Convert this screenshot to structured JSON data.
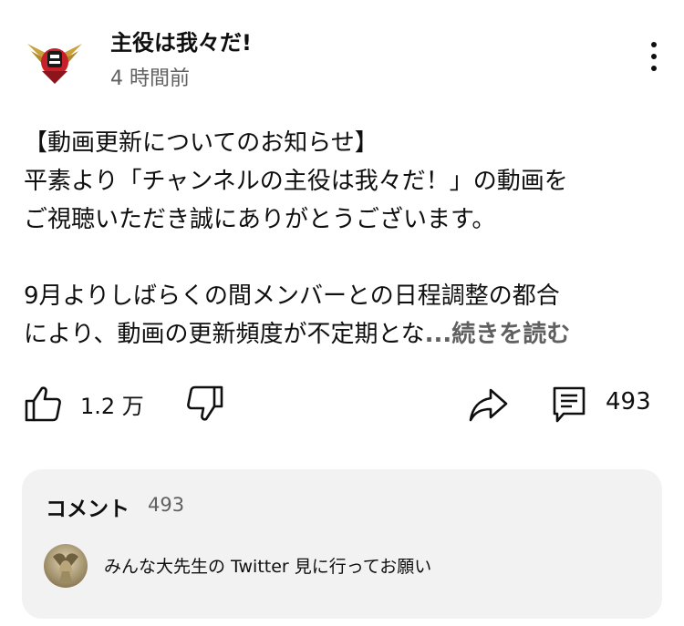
{
  "post": {
    "channel_name": "主役は我々だ!",
    "time_ago": "4 時間前",
    "body_lines": [
      "【動画更新についてのお知らせ】",
      "平素より「チャンネルの主役は我々だ！」の動画を",
      "ご視聴いただき誠にありがとうございます。",
      "",
      "9月よりしばらくの間メンバーとの日程調整の都合",
      "により、動画の更新頻度が不定期とな"
    ],
    "read_more": "...続きを読む"
  },
  "actions": {
    "like_count": "1.2 万",
    "comment_count": "493"
  },
  "comments": {
    "title": "コメント",
    "count": "493",
    "top_comment": "みんな大先生の Twitter 見に行ってお願い"
  },
  "icons": {
    "avatar": "channel-logo-icon",
    "more": "more-vertical-icon",
    "like": "thumbs-up-icon",
    "dislike": "thumbs-down-icon",
    "share": "share-icon",
    "comment": "comment-icon"
  },
  "colors": {
    "text_primary": "#0f0f0f",
    "text_secondary": "#606060",
    "panel_background": "#f2f2f2",
    "logo_red": "#c8202a",
    "logo_gold": "#c9a23a"
  }
}
